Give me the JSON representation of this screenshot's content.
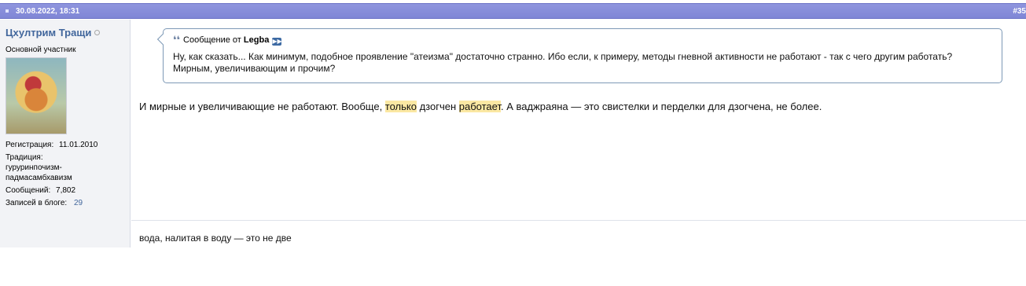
{
  "post": {
    "date": "30.08.2022, 18:31",
    "number": "#35"
  },
  "user": {
    "name": "Цхултрим Тращи",
    "title": "Основной участник",
    "registration_label": "Регистрация:",
    "registration_value": "11.01.2010",
    "tradition_label": "Традиция:",
    "tradition_value": "гуруринпочизм-падмасамбхавизм",
    "messages_label": "Сообщений:",
    "messages_value": "7,802",
    "blog_label": "Записей в блоге:",
    "blog_value": "29"
  },
  "quote": {
    "prefix": "Сообщение от",
    "author": "Legba",
    "text": "Ну, как сказать... Как минимум, подобное проявление \"атеизма\" достаточно странно. Ибо если, к примеру, методы гневной активности не работают - так с чего другим работать? Мирным, увеличивающим и прочим?"
  },
  "message": {
    "part1": "И мирные и увеличивающие не работают. Вообще, ",
    "highlight1": "только",
    "part2": " дзогчен ",
    "highlight2": "работает",
    "part3": ". А ваджраяна — это свистелки и перделки для дзогчена, не более."
  },
  "signature": "вода, налитая в воду — это не две",
  "colors": {
    "header_bg": "#8a90dc",
    "username": "#41669c",
    "highlight": "#fbe8a3",
    "quote_border": "#7d99b6"
  },
  "icons": {
    "quote": "quote-icon",
    "goto_post": "goto-post-icon",
    "status": "offline-status-icon"
  }
}
